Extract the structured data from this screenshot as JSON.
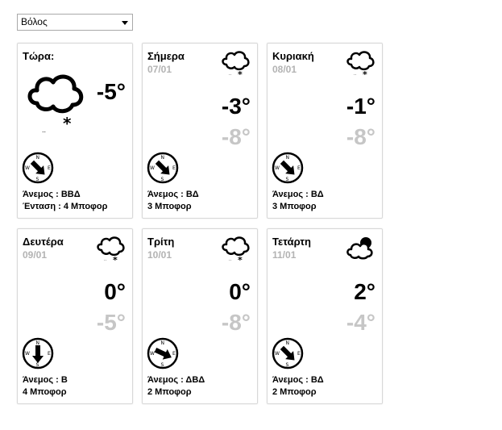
{
  "location_select": {
    "value": "Βόλος"
  },
  "now": {
    "label": "Τώρα:",
    "temp": "-5°",
    "icon": "cloud-snow-icon",
    "wind_line1": "Άνεμος : ΒΒΔ",
    "wind_line2": "Ένταση : 4 Μποφορ"
  },
  "days": [
    {
      "name": "Σήμερα",
      "date": "07/01",
      "hi": "-3°",
      "lo": "-8°",
      "icon": "cloud-snow-icon",
      "wind": "Άνεμος : ΒΔ",
      "force": "3 Μποφορ"
    },
    {
      "name": "Κυριακή",
      "date": "08/01",
      "hi": "-1°",
      "lo": "-8°",
      "icon": "cloud-snow-icon",
      "wind": "Άνεμος : ΒΔ",
      "force": "3 Μποφορ"
    },
    {
      "name": "Δευτέρα",
      "date": "09/01",
      "hi": "0°",
      "lo": "-5°",
      "icon": "cloud-snow-icon",
      "wind": "Άνεμος : Β",
      "force": "4 Μποφορ"
    },
    {
      "name": "Τρίτη",
      "date": "10/01",
      "hi": "0°",
      "lo": "-8°",
      "icon": "cloud-snow-icon",
      "wind": "Άνεμος : ΔΒΔ",
      "force": "2 Μποφορ"
    },
    {
      "name": "Τετάρτη",
      "date": "11/01",
      "hi": "2°",
      "lo": "-4°",
      "icon": "cloud-sun-icon",
      "wind": "Άνεμος : ΒΔ",
      "force": "2 Μποφορ"
    }
  ],
  "compass_letters": {
    "n": "N",
    "s": "S",
    "e": "E",
    "w": "W"
  }
}
